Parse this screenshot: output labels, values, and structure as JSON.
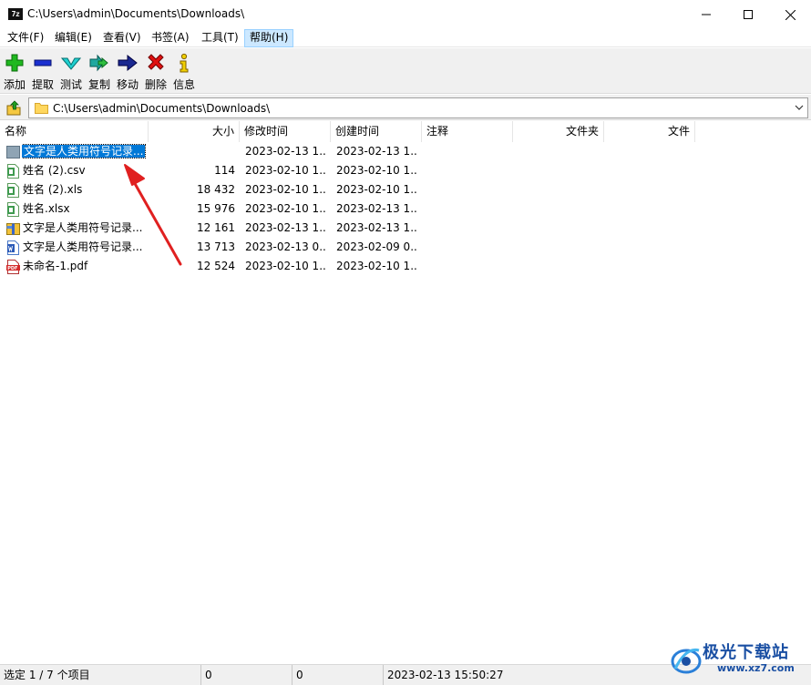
{
  "window": {
    "title": "C:\\Users\\admin\\Documents\\Downloads\\",
    "app_icon_text": "7z"
  },
  "menu": [
    "文件(F)",
    "编辑(E)",
    "查看(V)",
    "书签(A)",
    "工具(T)",
    "帮助(H)"
  ],
  "toolbar": [
    {
      "label": "添加",
      "icon": "plus-icon",
      "color": "#00a000"
    },
    {
      "label": "提取",
      "icon": "minus-icon",
      "color": "#0000c0"
    },
    {
      "label": "测试",
      "icon": "check-arrow-icon",
      "color": "#00a0a0"
    },
    {
      "label": "复制",
      "icon": "double-arrow-icon",
      "color": "#008080"
    },
    {
      "label": "移动",
      "icon": "right-arrow-icon",
      "color": "#000080"
    },
    {
      "label": "删除",
      "icon": "x-icon",
      "color": "#e00000"
    },
    {
      "label": "信息",
      "icon": "info-icon",
      "color": "#e0c000"
    }
  ],
  "address": {
    "path": "C:\\Users\\admin\\Documents\\Downloads\\"
  },
  "columns": [
    "名称",
    "大小",
    "修改时间",
    "创建时间",
    "注释",
    "文件夹",
    "文件"
  ],
  "files": [
    {
      "name": "文字是人类用符号记录...",
      "size": "",
      "modified": "2023-02-13 1...",
      "created": "2023-02-13 1...",
      "icon": "folder-icon",
      "selected": true
    },
    {
      "name": "姓名 (2).csv",
      "size": "114",
      "modified": "2023-02-10 1...",
      "created": "2023-02-10 1...",
      "icon": "csv-file-icon",
      "selected": false
    },
    {
      "name": "姓名 (2).xls",
      "size": "18 432",
      "modified": "2023-02-10 1...",
      "created": "2023-02-10 1...",
      "icon": "xls-file-icon",
      "selected": false
    },
    {
      "name": "姓名.xlsx",
      "size": "15 976",
      "modified": "2023-02-10 1...",
      "created": "2023-02-13 1...",
      "icon": "xlsx-file-icon",
      "selected": false
    },
    {
      "name": "文字是人类用符号记录...",
      "size": "12 161",
      "modified": "2023-02-13 1...",
      "created": "2023-02-13 1...",
      "icon": "zip-file-icon",
      "selected": false
    },
    {
      "name": "文字是人类用符号记录...",
      "size": "13 713",
      "modified": "2023-02-13 0...",
      "created": "2023-02-09 0...",
      "icon": "word-file-icon",
      "selected": false
    },
    {
      "name": "未命名-1.pdf",
      "size": "12 524",
      "modified": "2023-02-10 1...",
      "created": "2023-02-10 1...",
      "icon": "pdf-file-icon",
      "selected": false
    }
  ],
  "status": {
    "selection": "选定 1 / 7 个项目",
    "size": "0",
    "packed": "0",
    "datetime": "2023-02-13 15:50:27"
  },
  "watermark": {
    "text": "极光下载站",
    "url": "www.xz7.com"
  },
  "annotation": {
    "color": "#e02020"
  }
}
